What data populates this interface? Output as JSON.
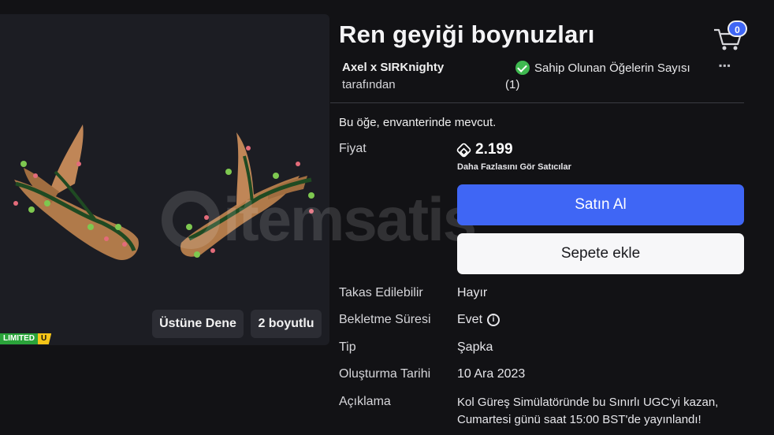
{
  "item": {
    "title": "Ren geyiği boynuzları",
    "creator": "Axel x SIRKnighty",
    "by_label": "tarafından",
    "owned_label": "Sahip Olunan Öğelerin Sayısı",
    "owned_count": "(1)",
    "more_icon": "more-icon",
    "inventory_note": "Bu öğe, envanterinde mevcut."
  },
  "cart": {
    "count": "0",
    "icon": "cart-icon"
  },
  "preview": {
    "try_on_label": "Üstüne Dene",
    "three_d_label": "2 boyutlu",
    "limited_label": "LIMITED",
    "limited_u": "U"
  },
  "purchase": {
    "price_label": "Fiyat",
    "price_value": "2.199",
    "sellers_link": "Daha Fazlasını Gör Satıcılar",
    "buy_label": "Satın Al",
    "add_cart_label": "Sepete ekle"
  },
  "details": [
    {
      "label": "Takas Edilebilir",
      "value": "Hayır"
    },
    {
      "label": "Bekletme Süresi",
      "value": "Evet"
    },
    {
      "label": "Tip",
      "value": "Şapka"
    },
    {
      "label": "Oluşturma Tarihi",
      "value": "10 Ara 2023"
    },
    {
      "label": "Açıklama",
      "value": "Kol Güreş Simülatöründe bu Sınırlı UGC'yi kazan, Cumartesi günü saat 15:00 BST'de yayınlandı!"
    }
  ],
  "watermark": "itemsatis",
  "colors": {
    "accent": "#3f66f5",
    "success": "#3fb950",
    "limited": "#2aa33a",
    "limited_u": "#f5c518"
  }
}
